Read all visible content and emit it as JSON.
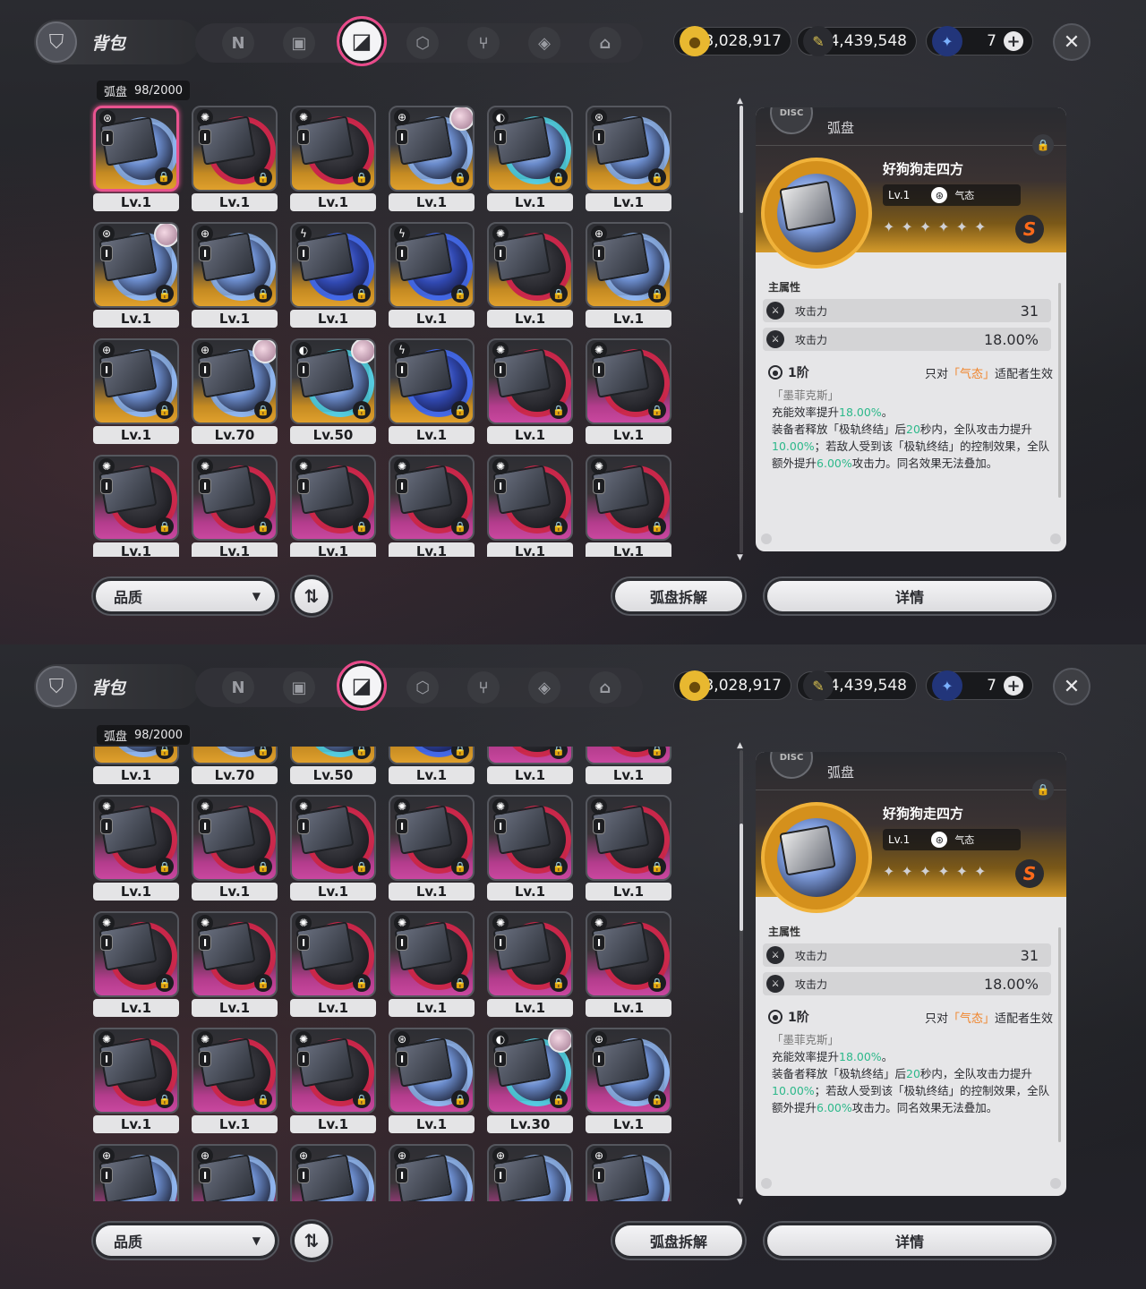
{
  "topbar": {
    "title": "背包",
    "bag_icon": "backpack-icon",
    "tabs": [
      {
        "icon": "n-logo-icon",
        "glyph": "N"
      },
      {
        "icon": "gameboy-icon",
        "glyph": "▣"
      },
      {
        "icon": "disc-drive-icon",
        "glyph": "◪",
        "active": true
      },
      {
        "icon": "cube-icon",
        "glyph": "⬡"
      },
      {
        "icon": "utensils-icon",
        "glyph": "⑂"
      },
      {
        "icon": "cube-outline-icon",
        "glyph": "◈"
      },
      {
        "icon": "home-icon",
        "glyph": "⌂"
      }
    ],
    "currencies": [
      {
        "icon": "dennies-coin-icon",
        "value": "3,028,917",
        "color": "#e8b830"
      },
      {
        "icon": "polychrome-ticket-icon",
        "value": "4,439,548",
        "color": "#d8c050"
      },
      {
        "icon": "energy-orb-icon",
        "value": "7",
        "color": "#3a72d8"
      }
    ],
    "close_icon": "close-icon"
  },
  "inventory": {
    "category": "弧盘",
    "count": "98/2000"
  },
  "panels": [
    {
      "rows": [
        [
          {
            "lv": "Lv.1",
            "color": "gold",
            "disc": "",
            "elem": "⊛",
            "selected": true
          },
          {
            "lv": "Lv.1",
            "color": "gold",
            "disc": "red",
            "elem": "✺"
          },
          {
            "lv": "Lv.1",
            "color": "gold",
            "disc": "red",
            "elem": "✺"
          },
          {
            "lv": "Lv.1",
            "color": "gold",
            "disc": "",
            "elem": "⊕",
            "avatar": true
          },
          {
            "lv": "Lv.1",
            "color": "gold",
            "disc": "cyan",
            "elem": "◐"
          },
          {
            "lv": "Lv.1",
            "color": "gold",
            "disc": "",
            "elem": "⊛"
          }
        ],
        [
          {
            "lv": "Lv.1",
            "color": "gold",
            "disc": "",
            "elem": "⊛",
            "avatar": true
          },
          {
            "lv": "Lv.1",
            "color": "gold",
            "disc": "",
            "elem": "⊕"
          },
          {
            "lv": "Lv.1",
            "color": "gold",
            "disc": "blue",
            "elem": "ϟ"
          },
          {
            "lv": "Lv.1",
            "color": "gold",
            "disc": "blue",
            "elem": "ϟ"
          },
          {
            "lv": "Lv.1",
            "color": "gold",
            "disc": "red",
            "elem": "✺"
          },
          {
            "lv": "Lv.1",
            "color": "gold",
            "disc": "",
            "elem": "⊕"
          }
        ],
        [
          {
            "lv": "Lv.1",
            "color": "gold",
            "disc": "",
            "elem": "⊕"
          },
          {
            "lv": "Lv.70",
            "color": "gold",
            "disc": "",
            "elem": "⊕",
            "avatar": true
          },
          {
            "lv": "Lv.50",
            "color": "gold",
            "disc": "cyan",
            "elem": "◐",
            "avatar": true
          },
          {
            "lv": "Lv.1",
            "color": "gold",
            "disc": "blue",
            "elem": "ϟ"
          },
          {
            "lv": "Lv.1",
            "color": "pink",
            "disc": "red",
            "elem": "✺"
          },
          {
            "lv": "Lv.1",
            "color": "pink",
            "disc": "red",
            "elem": "✺"
          }
        ],
        [
          {
            "lv": "Lv.1",
            "color": "pink",
            "disc": "red",
            "elem": "✺"
          },
          {
            "lv": "Lv.1",
            "color": "pink",
            "disc": "red",
            "elem": "✺"
          },
          {
            "lv": "Lv.1",
            "color": "pink",
            "disc": "red",
            "elem": "✺"
          },
          {
            "lv": "Lv.1",
            "color": "pink",
            "disc": "red",
            "elem": "✺"
          },
          {
            "lv": "Lv.1",
            "color": "pink",
            "disc": "red",
            "elem": "✺"
          },
          {
            "lv": "Lv.1",
            "color": "pink",
            "disc": "red",
            "elem": "✺"
          }
        ]
      ]
    },
    {
      "rows": [
        [
          {
            "lv": "Lv.1",
            "color": "gold",
            "disc": "",
            "elem": "⊕"
          },
          {
            "lv": "Lv.70",
            "color": "gold",
            "disc": "",
            "elem": "⊕"
          },
          {
            "lv": "Lv.50",
            "color": "gold",
            "disc": "cyan",
            "elem": "◐"
          },
          {
            "lv": "Lv.1",
            "color": "gold",
            "disc": "blue",
            "elem": "ϟ"
          },
          {
            "lv": "Lv.1",
            "color": "pink",
            "disc": "red",
            "elem": "✺"
          },
          {
            "lv": "Lv.1",
            "color": "pink",
            "disc": "red",
            "elem": "✺"
          }
        ],
        [
          {
            "lv": "Lv.1",
            "color": "pink",
            "disc": "red",
            "elem": "✺"
          },
          {
            "lv": "Lv.1",
            "color": "pink",
            "disc": "red",
            "elem": "✺"
          },
          {
            "lv": "Lv.1",
            "color": "pink",
            "disc": "red",
            "elem": "✺"
          },
          {
            "lv": "Lv.1",
            "color": "pink",
            "disc": "red",
            "elem": "✺"
          },
          {
            "lv": "Lv.1",
            "color": "pink",
            "disc": "red",
            "elem": "✺"
          },
          {
            "lv": "Lv.1",
            "color": "pink",
            "disc": "red",
            "elem": "✺"
          }
        ],
        [
          {
            "lv": "Lv.1",
            "color": "pink",
            "disc": "red",
            "elem": "✺"
          },
          {
            "lv": "Lv.1",
            "color": "pink",
            "disc": "red",
            "elem": "✺"
          },
          {
            "lv": "Lv.1",
            "color": "pink",
            "disc": "red",
            "elem": "✺"
          },
          {
            "lv": "Lv.1",
            "color": "pink",
            "disc": "red",
            "elem": "✺"
          },
          {
            "lv": "Lv.1",
            "color": "pink",
            "disc": "red",
            "elem": "✺"
          },
          {
            "lv": "Lv.1",
            "color": "pink",
            "disc": "red",
            "elem": "✺"
          }
        ],
        [
          {
            "lv": "Lv.1",
            "color": "pink",
            "disc": "red",
            "elem": "✺"
          },
          {
            "lv": "Lv.1",
            "color": "pink",
            "disc": "red",
            "elem": "✺"
          },
          {
            "lv": "Lv.1",
            "color": "pink",
            "disc": "red",
            "elem": "✺"
          },
          {
            "lv": "Lv.1",
            "color": "pink",
            "disc": "",
            "elem": "⊛"
          },
          {
            "lv": "Lv.30",
            "color": "pink",
            "disc": "cyan",
            "elem": "◐",
            "avatar": true
          },
          {
            "lv": "Lv.1",
            "color": "pink",
            "disc": "",
            "elem": "⊕"
          }
        ],
        [
          {
            "lv": "",
            "color": "pink",
            "disc": "",
            "elem": "⊕"
          },
          {
            "lv": "",
            "color": "pink",
            "disc": "",
            "elem": "⊕"
          },
          {
            "lv": "",
            "color": "pink",
            "disc": "",
            "elem": "⊕"
          },
          {
            "lv": "",
            "color": "pink",
            "disc": "",
            "elem": "⊕"
          },
          {
            "lv": "",
            "color": "pink",
            "disc": "",
            "elem": "⊕"
          },
          {
            "lv": "",
            "color": "pink",
            "disc": "",
            "elem": "⊕"
          }
        ]
      ]
    }
  ],
  "detail": {
    "type": "弧盘",
    "type_icon_text": "DISC",
    "name": "好狗狗走四方",
    "level": "Lv.1",
    "element_glyph": "⊛",
    "element": "气态",
    "stars": [
      "✦",
      "✦",
      "✦",
      "✦",
      "✦",
      "✦"
    ],
    "rank": "S",
    "main_attr_label": "主属性",
    "stats": [
      {
        "icon": "attack-icon",
        "name": "攻击力",
        "value": "31"
      },
      {
        "icon": "attack-icon",
        "name": "攻击力",
        "value": "18.00%"
      }
    ],
    "set_icon": "target-icon",
    "set_tier": "1阶",
    "set_cond_prefix": "只对",
    "set_cond_highlight": "「气态」",
    "set_cond_suffix": "适配者生效",
    "set_name": "「墨菲克斯」",
    "desc_line1_a": "充能效率提升",
    "desc_line1_b": "18.00%",
    "desc_line1_c": "。",
    "desc_a": "装备者释放「极轨终结」后",
    "desc_b": "20",
    "desc_c": "秒内，全队攻击力提升",
    "desc_d": "10.00%",
    "desc_e": "；若敌人受到该「极轨终结」的控制效果，全队额外提升",
    "desc_f": "6.00%",
    "desc_g": "攻击力。同名效果无法叠加。"
  },
  "bottom": {
    "quality_label": "品质",
    "sort_icon": "sort-icon",
    "dismantle_label": "弧盘拆解",
    "details_label": "详情"
  }
}
